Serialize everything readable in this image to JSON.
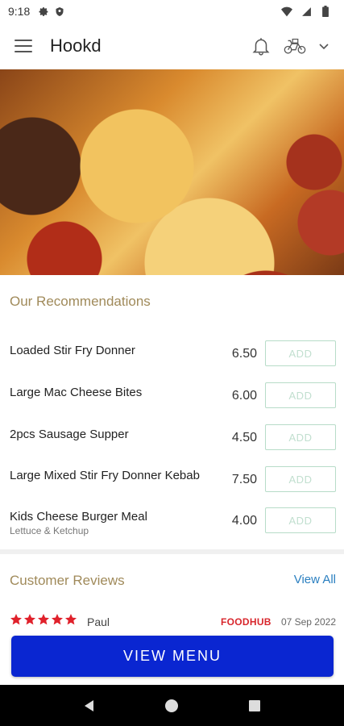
{
  "status_bar": {
    "time": "9:18"
  },
  "app_bar": {
    "title": "Hookd"
  },
  "recommendations": {
    "heading": "Our Recommendations",
    "items": [
      {
        "name": "Loaded Stir Fry Donner",
        "description": "",
        "price": "6.50",
        "button": "ADD"
      },
      {
        "name": "Large Mac Cheese Bites",
        "description": "",
        "price": "6.00",
        "button": "ADD"
      },
      {
        "name": "2pcs Sausage Supper",
        "description": "",
        "price": "4.50",
        "button": "ADD"
      },
      {
        "name": "Large Mixed Stir Fry Donner Kebab",
        "description": "",
        "price": "7.50",
        "button": "ADD"
      },
      {
        "name": "Kids Cheese Burger Meal",
        "description": "Lettuce & Ketchup",
        "price": "4.00",
        "button": "ADD"
      }
    ]
  },
  "reviews": {
    "heading": "Customer Reviews",
    "view_all": "View All",
    "items": [
      {
        "rating": 5,
        "reviewer": "Paul",
        "source": "FOODHUB",
        "date": "07 Sep 2022"
      }
    ]
  },
  "view_menu_button": "VIEW MENU",
  "colors": {
    "accent": "#0a26d1",
    "section_heading": "#a08a5a",
    "add_button_border": "#b7dcc8",
    "star": "#e0212b",
    "link": "#2a7fc0",
    "foodhub": "#d8262c"
  },
  "icons": [
    "settings-icon",
    "shield-icon",
    "wifi-icon",
    "signal-icon",
    "battery-icon",
    "menu-icon",
    "bell-icon",
    "delivery-bike-icon",
    "chevron-down-icon",
    "star-icon",
    "back-icon",
    "home-icon",
    "recents-icon"
  ]
}
